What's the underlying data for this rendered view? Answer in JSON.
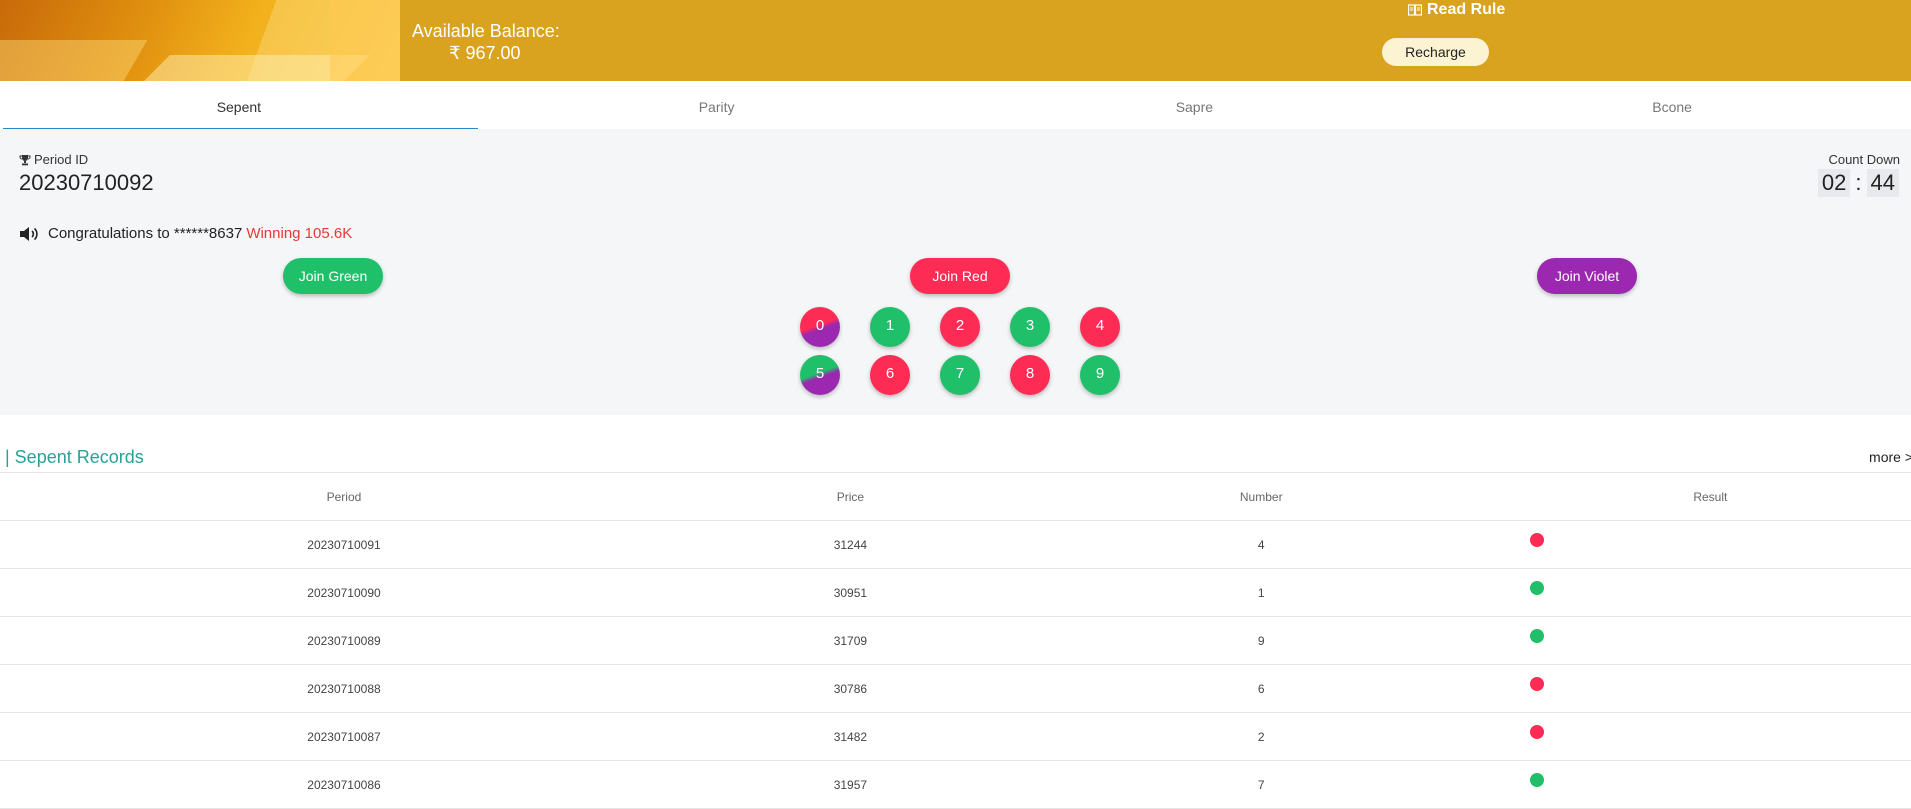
{
  "header": {
    "balance_label": "Available Balance:",
    "balance_value": "₹ 967.00",
    "read_rule": "Read Rule",
    "recharge": "Recharge"
  },
  "tabs": [
    {
      "label": "Sepent",
      "active": true
    },
    {
      "label": "Parity",
      "active": false
    },
    {
      "label": "Sapre",
      "active": false
    },
    {
      "label": "Bcone",
      "active": false
    }
  ],
  "game": {
    "period_label": "Period ID",
    "period_value": "20230710092",
    "countdown_label": "Count Down",
    "countdown_min": "02",
    "countdown_sep": ":",
    "countdown_sec": "44",
    "congrats_text": "Congratulations to ******8637",
    "winning_text": "Winning 105.6K",
    "join_green": "Join Green",
    "join_red": "Join Red",
    "join_violet": "Join Violet",
    "numbers": [
      {
        "label": "0",
        "color": "red-violet"
      },
      {
        "label": "1",
        "color": "green"
      },
      {
        "label": "2",
        "color": "red"
      },
      {
        "label": "3",
        "color": "green"
      },
      {
        "label": "4",
        "color": "red"
      },
      {
        "label": "5",
        "color": "green-violet"
      },
      {
        "label": "6",
        "color": "red"
      },
      {
        "label": "7",
        "color": "green"
      },
      {
        "label": "8",
        "color": "red"
      },
      {
        "label": "9",
        "color": "green"
      }
    ]
  },
  "records": {
    "title": "| Sepent Records",
    "more": "more >",
    "columns": [
      "Period",
      "Price",
      "Number",
      "Result"
    ],
    "rows": [
      {
        "period": "20230710091",
        "price": "31244",
        "number": "4",
        "result": "red"
      },
      {
        "period": "20230710090",
        "price": "30951",
        "number": "1",
        "result": "green"
      },
      {
        "period": "20230710089",
        "price": "31709",
        "number": "9",
        "result": "green"
      },
      {
        "period": "20230710088",
        "price": "30786",
        "number": "6",
        "result": "red"
      },
      {
        "period": "20230710087",
        "price": "31482",
        "number": "2",
        "result": "red"
      },
      {
        "period": "20230710086",
        "price": "31957",
        "number": "7",
        "result": "green"
      }
    ]
  },
  "colors": {
    "header_bg": "#d9a31f",
    "green": "#20c06a",
    "red": "#fe2c55",
    "violet": "#9c27b0",
    "accent_teal": "#2aa198",
    "tab_underline": "#2b88c8"
  },
  "icons": [
    "book-icon",
    "trophy-icon",
    "speaker-icon"
  ]
}
